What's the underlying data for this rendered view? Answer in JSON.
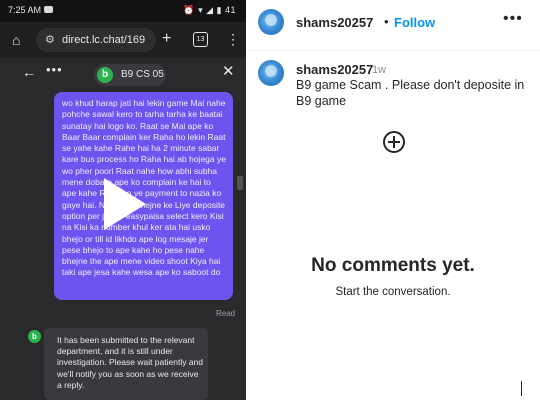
{
  "status_bar": {
    "time": "7:25 AM",
    "system_icons": "⏰ ▾ ◢ ▮ 41"
  },
  "browser": {
    "url": "direct.lc.chat/169",
    "tab_count": "13"
  },
  "chat": {
    "agent_name": "B9 CS 05",
    "logo_letter": "b",
    "user_message": "wo khud harap jati hai lekin game Mai nahe pohche sawal kero to tarha tarha ke baatai sunatay hai logo ko. Raat se Mai ape ko Baar Baar complain ker Raha ho lekin Raat se yahe kahe Rahe hai ha 2 minute sabar kare bus process ho Raha hai ab hojega ye wo pher poori Raat nahe how abhi subha mene dobara ape ko complain ke hai to ape kahe Rahe ho ye payment to nazia ko gaye hai. Nazia Ko bhejne ke Liye deposite option per jao or easypaisa select kero Kisi na Kisi ka number khul ker ata hai usko bhejo or till id likhdo ape log mesaje jer pese bhejo to ape kahe ho pese nahe bhejne the ape mene video shoot Kiya hai taki ape jesa kahe wesa ape ko saboot do",
    "read_label": "Read",
    "agent_reply": "It has been submitted to the relevant department, and it is still under investigation. Please wait patiently and we'll notify you as soon as we receive a reply."
  },
  "post": {
    "username": "shams20257",
    "follow_label": "Follow",
    "caption_username": "shams20257",
    "time_ago": "1w",
    "caption": "B9 game Scam . Please don't deposite in B9 game",
    "empty_title": "No comments yet.",
    "empty_subtitle": "Start the conversation."
  }
}
